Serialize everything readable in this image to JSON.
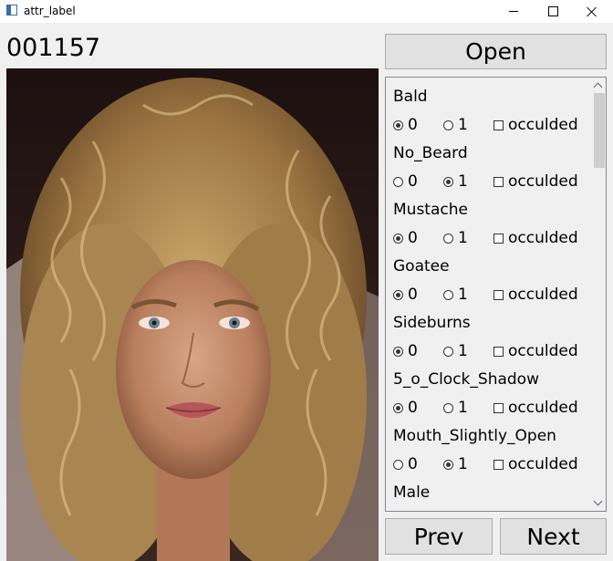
{
  "window": {
    "title": "attr_label"
  },
  "image_id": "001157",
  "buttons": {
    "open": "Open",
    "prev": "Prev",
    "next": "Next"
  },
  "options": {
    "zero": "0",
    "one": "1",
    "occluded": "occulded"
  },
  "attributes": [
    {
      "name": "Bald",
      "selected": "0",
      "occluded": false
    },
    {
      "name": "No_Beard",
      "selected": "1",
      "occluded": false
    },
    {
      "name": "Mustache",
      "selected": "0",
      "occluded": false
    },
    {
      "name": "Goatee",
      "selected": "0",
      "occluded": false
    },
    {
      "name": "Sideburns",
      "selected": "0",
      "occluded": false
    },
    {
      "name": "5_o_Clock_Shadow",
      "selected": "0",
      "occluded": false
    },
    {
      "name": "Mouth_Slightly_Open",
      "selected": "1",
      "occluded": false
    },
    {
      "name": "Male",
      "selected": null,
      "occluded": false
    }
  ],
  "icons": {
    "app": "window-app-icon",
    "minimize": "minimize-icon",
    "maximize": "maximize-icon",
    "close": "close-icon",
    "scroll_up": "chevron-up-icon",
    "scroll_down": "chevron-down-icon"
  },
  "colors": {
    "window_bg": "#f0f0f0",
    "button_bg": "#e1e1e1",
    "button_border": "#adadad"
  }
}
